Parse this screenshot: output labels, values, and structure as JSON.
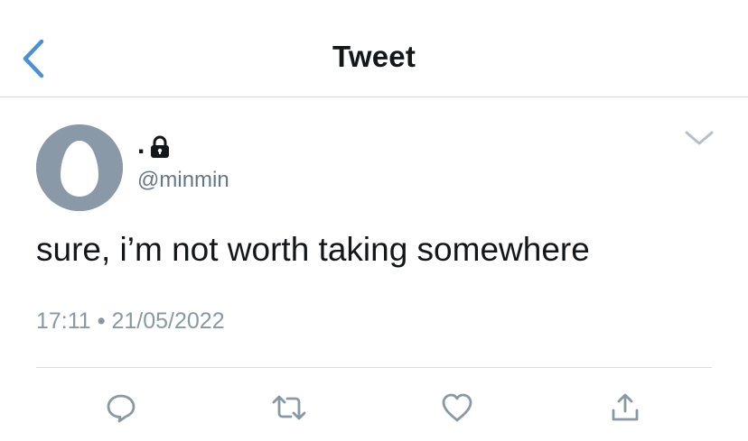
{
  "header": {
    "title": "Tweet",
    "back_icon": "chevron-left-icon"
  },
  "tweet": {
    "display_name": ".",
    "handle": "@minmin",
    "protected_icon": "lock-icon",
    "text": "sure, i’m not worth taking somewhere",
    "time": "17:11",
    "separator": "•",
    "date": "21/05/2022",
    "more_icon": "chevron-down-icon"
  },
  "actions": [
    {
      "name": "reply",
      "icon": "speech-bubble-icon"
    },
    {
      "name": "retweet",
      "icon": "retweet-icon"
    },
    {
      "name": "like",
      "icon": "heart-icon"
    },
    {
      "name": "share",
      "icon": "share-icon"
    }
  ],
  "colors": {
    "accent": "#4a90d9",
    "text": "#14171a",
    "secondary_text": "#657786",
    "icon_gray": "#8899a6",
    "avatar_bg": "#8a99a8",
    "divider": "#d9dde1"
  }
}
